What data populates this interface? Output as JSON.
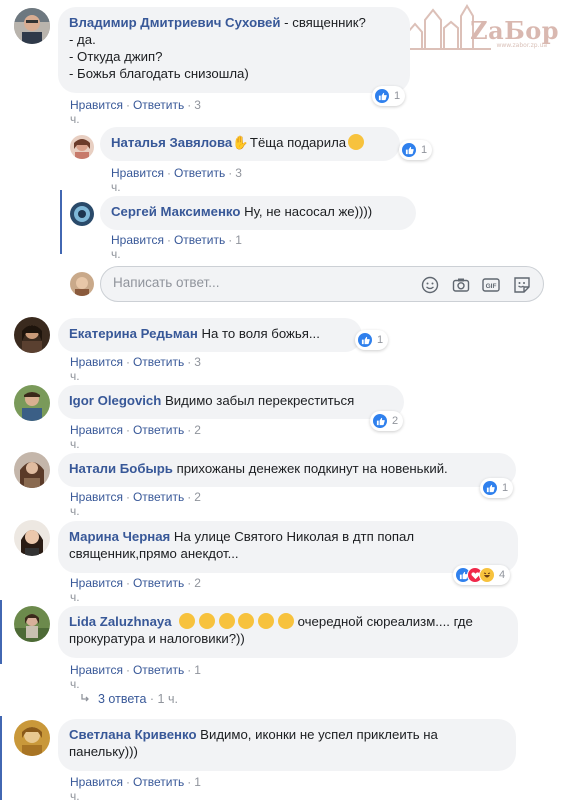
{
  "watermark": {
    "logo": "ZaБор",
    "sub": "www.zabor.zp.ua"
  },
  "comments": [
    {
      "author": "Владимир Дмитриевич Суховей",
      "text": " - священник?\n- да.\n- Откуда джип?\n- Божья благодать снизошла)",
      "like": "Нравится",
      "reply": "Ответить",
      "time": "3 ч.",
      "reactions": "1"
    },
    {
      "author": "Наталья Завялова",
      "text": " Тёща подарила",
      "like": "Нравится",
      "reply": "Ответить",
      "time": "3 ч.",
      "reactions": "1"
    },
    {
      "author": "Сергей Максименко",
      "text": " Ну, не насосал же))))",
      "like": "Нравится",
      "reply": "Ответить",
      "time": "1 ч."
    },
    {
      "author": "Екатерина Редьман",
      "text": " На то воля божья...",
      "like": "Нравится",
      "reply": "Ответить",
      "time": "3 ч.",
      "reactions": "1"
    },
    {
      "author": "Igor Olegovich",
      "text": " Видимо забыл перекреститься",
      "like": "Нравится",
      "reply": "Ответить",
      "time": "2 ч.",
      "reactions": "2"
    },
    {
      "author": "Натали Бобырь",
      "text": " прихожаны денежек подкинут на новенький.",
      "like": "Нравится",
      "reply": "Ответить",
      "time": "2 ч.",
      "reactions": "1"
    },
    {
      "author": "Марина Черная",
      "text": " На улице Святого Николая в дтп попал священник,прямо анекдот...",
      "like": "Нравится",
      "reply": "Ответить",
      "time": "2 ч.",
      "reactions": "4"
    },
    {
      "author": "Lida Zaluzhnaya",
      "text": "очередной сюреализм.... где прокуратура и налоговики?))",
      "like": "Нравится",
      "reply": "Ответить",
      "time": "1 ч."
    },
    {
      "author": "Светлана Кривенко",
      "text": " Видимо, иконки не успел приклеить на панельку)))",
      "like": "Нравится",
      "reply": "Ответить",
      "time": "1 ч."
    }
  ],
  "reply_box": {
    "placeholder": "Написать ответ..."
  },
  "more_replies": {
    "label": "3 ответа",
    "sep": "·",
    "time": "1 ч."
  },
  "colors": {
    "author": "#385898",
    "bubble": "#f2f3f5",
    "like_blue": "#2f80ed",
    "thread": "#4267b2"
  }
}
